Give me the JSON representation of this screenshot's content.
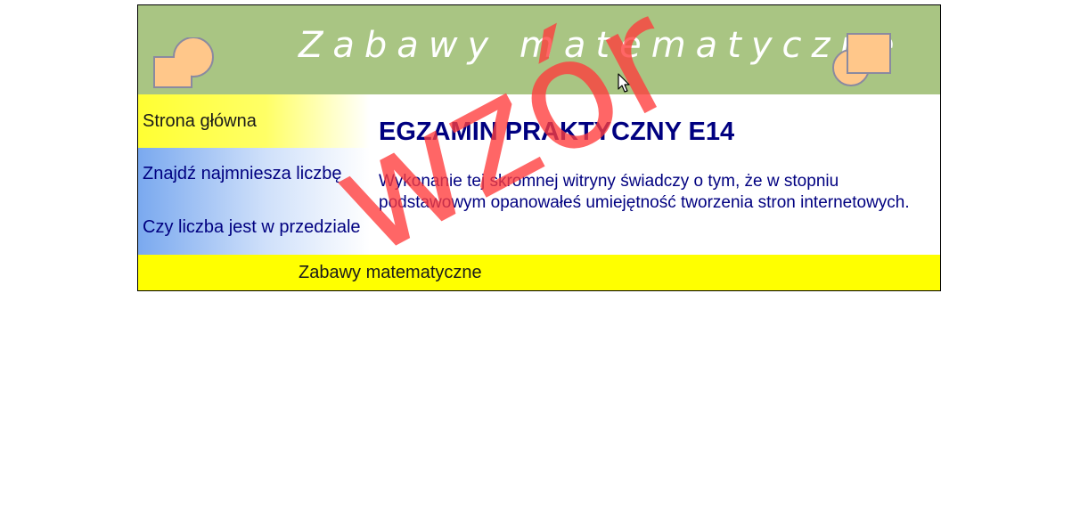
{
  "banner": {
    "title": "Zabawy matematyczne"
  },
  "menu": {
    "items": [
      {
        "label": "Strona główna"
      },
      {
        "label": "Znajdź najmniesza liczbę"
      },
      {
        "label": "Czy liczba jest w przedziale"
      }
    ]
  },
  "content": {
    "heading": "EGZAMIN PRAKTYCZNY E14",
    "text": "Wykonanie tej skromnej witryny świadczy o tym, że w stopniu podstawowym opanowałeś umiejętność tworzenia stron internetowych."
  },
  "footer": {
    "text": "Zabawy matematyczne"
  },
  "watermark": {
    "text": "wzór"
  },
  "colors": {
    "banner": "#a9c583",
    "footer": "#ffff00",
    "text": "#000080",
    "logo_fill": "#ffc78a",
    "logo_stroke": "#8a8aa0",
    "watermark": "#ff3b3b"
  },
  "icons": {
    "logo_left": "circle-square-logo-icon",
    "logo_right": "square-circle-logo-icon",
    "cursor": "mouse-pointer-icon"
  }
}
